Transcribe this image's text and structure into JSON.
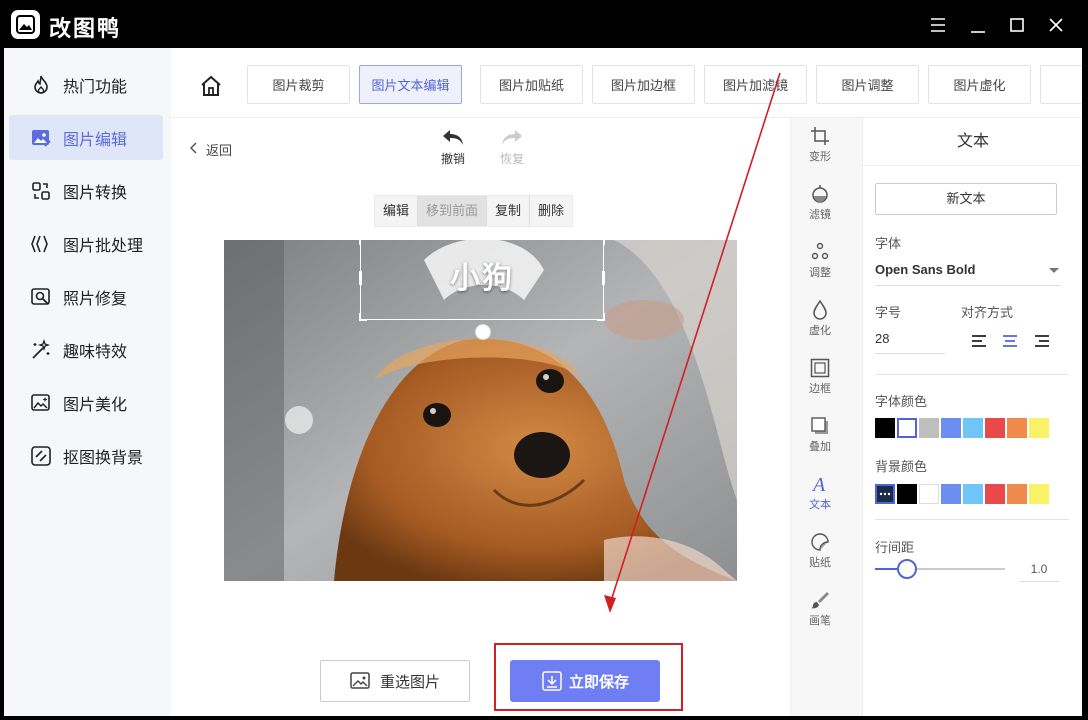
{
  "window": {
    "title": "改图鸭"
  },
  "sidebar": {
    "items": [
      {
        "label": "热门功能",
        "icon": "fire-icon"
      },
      {
        "label": "图片编辑",
        "icon": "image-edit-icon",
        "active": true
      },
      {
        "label": "图片转换",
        "icon": "convert-icon"
      },
      {
        "label": "图片批处理",
        "icon": "batch-icon"
      },
      {
        "label": "照片修复",
        "icon": "repair-icon"
      },
      {
        "label": "趣味特效",
        "icon": "magic-wand-icon"
      },
      {
        "label": "图片美化",
        "icon": "beautify-icon"
      },
      {
        "label": "抠图换背景",
        "icon": "cutout-icon"
      }
    ]
  },
  "toolbar": {
    "tabs": [
      {
        "label": "图片裁剪"
      },
      {
        "label": "图片文本编辑",
        "active": true
      },
      {
        "label": "图片加贴纸"
      },
      {
        "label": "图片加边框"
      },
      {
        "label": "图片加滤镜"
      },
      {
        "label": "图片调整"
      },
      {
        "label": "图片虚化"
      }
    ]
  },
  "editor": {
    "back_label": "返回",
    "undo_label": "撤销",
    "redo_label": "恢复",
    "context_menu": {
      "edit": "编辑",
      "bring_front": "移到前面",
      "copy": "复制",
      "delete": "删除"
    },
    "overlay_text": "小狗",
    "reselect_label": "重选图片",
    "save_label": "立即保存"
  },
  "tools": [
    {
      "label": "变形",
      "icon": "crop-icon"
    },
    {
      "label": "滤镜",
      "icon": "filter-icon"
    },
    {
      "label": "调整",
      "icon": "adjust-icon"
    },
    {
      "label": "虚化",
      "icon": "blur-icon"
    },
    {
      "label": "边框",
      "icon": "border-icon"
    },
    {
      "label": "叠加",
      "icon": "overlay-icon"
    },
    {
      "label": "文本",
      "icon": "text-icon",
      "active": true
    },
    {
      "label": "贴纸",
      "icon": "sticker-icon"
    },
    {
      "label": "画笔",
      "icon": "brush-icon"
    }
  ],
  "panel": {
    "title": "文本",
    "new_text_label": "新文本",
    "font_label": "字体",
    "font_value": "Open Sans Bold",
    "size_label": "字号",
    "size_value": "28",
    "align_label": "对齐方式",
    "align_selected": "center",
    "font_color_label": "字体颜色",
    "font_colors": [
      "#000000",
      "#ffffff",
      "#bfbfbf",
      "#6a8ff0",
      "#6ec6f7",
      "#e84a4a",
      "#f08a4a",
      "#f9f166"
    ],
    "font_color_selected": "#ffffff",
    "bg_color_label": "背景颜色",
    "bg_colors": [
      "transparent",
      "#000000",
      "#ffffff",
      "#6a8ff0",
      "#6ec6f7",
      "#e84a4a",
      "#f08a4a",
      "#f9f166"
    ],
    "bg_color_selected": "transparent",
    "line_spacing_label": "行间距",
    "line_spacing_value": "1.0"
  },
  "colors": {
    "accent": "#5b6ce0",
    "save_button": "#6f7ff3",
    "highlight_box": "#d11f26"
  }
}
